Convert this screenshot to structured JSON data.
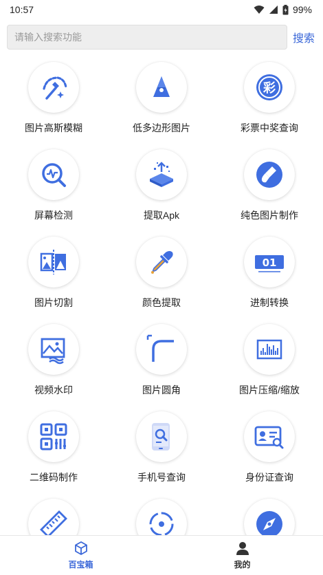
{
  "status_bar": {
    "time": "10:57",
    "battery": "99%"
  },
  "search": {
    "placeholder": "请输入搜索功能",
    "button_label": "搜索"
  },
  "tools": [
    {
      "label": "图片高斯模糊",
      "icon": "magic-wand-icon"
    },
    {
      "label": "低多边形图片",
      "icon": "low-poly-icon"
    },
    {
      "label": "彩票中奖查询",
      "icon": "lottery-icon"
    },
    {
      "label": "屏幕检测",
      "icon": "screen-detect-icon"
    },
    {
      "label": "提取Apk",
      "icon": "extract-apk-icon"
    },
    {
      "label": "纯色图片制作",
      "icon": "solid-color-icon"
    },
    {
      "label": "图片切割",
      "icon": "image-split-icon"
    },
    {
      "label": "颜色提取",
      "icon": "color-picker-icon"
    },
    {
      "label": "进制转换",
      "icon": "base-convert-icon"
    },
    {
      "label": "视频水印",
      "icon": "video-watermark-icon"
    },
    {
      "label": "图片圆角",
      "icon": "rounded-corner-icon"
    },
    {
      "label": "图片压缩/缩放",
      "icon": "image-compress-icon"
    },
    {
      "label": "二维码制作",
      "icon": "qr-code-icon"
    },
    {
      "label": "手机号查询",
      "icon": "phone-lookup-icon"
    },
    {
      "label": "身份证查询",
      "icon": "id-card-icon"
    },
    {
      "label": "",
      "icon": "ruler-icon"
    },
    {
      "label": "",
      "icon": "target-icon"
    },
    {
      "label": "",
      "icon": "compass-icon"
    }
  ],
  "base_convert_text": "01",
  "lottery_glyph": "彩",
  "bottom_nav": [
    {
      "label": "百宝箱",
      "icon": "toolbox-icon",
      "active": true
    },
    {
      "label": "我的",
      "icon": "user-icon",
      "active": false
    }
  ],
  "colors": {
    "accent": "#3a67d8",
    "icon_blue": "#3f6ee0"
  }
}
